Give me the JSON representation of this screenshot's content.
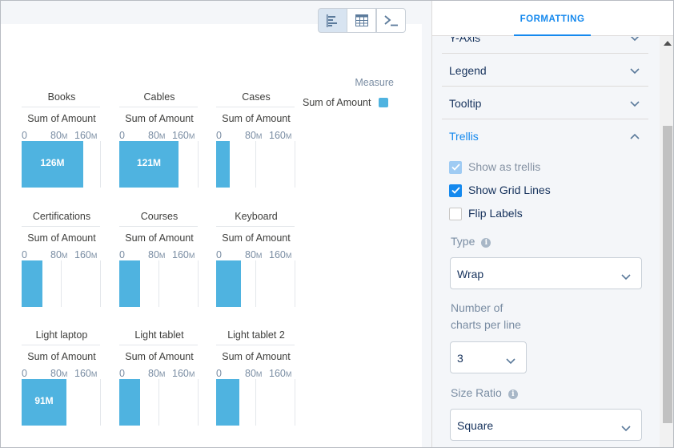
{
  "toolbar": {
    "view_buttons": [
      {
        "icon": "bar-chart-icon",
        "active": true
      },
      {
        "icon": "table-grid-icon",
        "active": false
      },
      {
        "icon": "terminal-icon",
        "active": false
      }
    ]
  },
  "colors": {
    "bar": "#4fb3e0",
    "accent": "#1589ee"
  },
  "chart_data": {
    "type": "bar",
    "orientation": "horizontal",
    "trellis": true,
    "measure": "Sum of Amount",
    "legend": {
      "title": "Measure",
      "entries": [
        "Sum of Amount"
      ],
      "position": "right"
    },
    "xlim": [
      0,
      160000000
    ],
    "ticks": [
      {
        "value": 0,
        "num": "0",
        "unit": ""
      },
      {
        "value": 80000000,
        "num": "80",
        "unit": "M"
      },
      {
        "value": 160000000,
        "num": "160",
        "unit": "M"
      }
    ],
    "grid": true,
    "panels": [
      {
        "category": "Books",
        "value": 126000000,
        "label": "126M"
      },
      {
        "category": "Cables",
        "value": 121000000,
        "label": "121M"
      },
      {
        "category": "Cases",
        "value": 28000000,
        "label": ""
      },
      {
        "category": "Certifications",
        "value": 43000000,
        "label": ""
      },
      {
        "category": "Courses",
        "value": 43000000,
        "label": ""
      },
      {
        "category": "Keyboard",
        "value": 51000000,
        "label": ""
      },
      {
        "category": "Light laptop",
        "value": 91000000,
        "label": "91M"
      },
      {
        "category": "Light tablet",
        "value": 43000000,
        "label": ""
      },
      {
        "category": "Light tablet 2",
        "value": 48000000,
        "label": ""
      }
    ]
  },
  "panel": {
    "tab": "FORMATTING",
    "sections": [
      {
        "title": "Y-Axis",
        "expanded": false
      },
      {
        "title": "Legend",
        "expanded": false
      },
      {
        "title": "Tooltip",
        "expanded": false
      },
      {
        "title": "Trellis",
        "expanded": true
      }
    ],
    "trellis": {
      "show_as_trellis": {
        "label": "Show as trellis",
        "checked": true,
        "disabled": true
      },
      "show_grid_lines": {
        "label": "Show Grid Lines",
        "checked": true
      },
      "flip_labels": {
        "label": "Flip Labels",
        "checked": false
      },
      "type": {
        "label": "Type",
        "value": "Wrap"
      },
      "charts_per_line": {
        "label_line1": "Number of",
        "label_line2": "charts per line",
        "value": "3"
      },
      "size_ratio": {
        "label": "Size Ratio",
        "value": "Square"
      }
    }
  }
}
